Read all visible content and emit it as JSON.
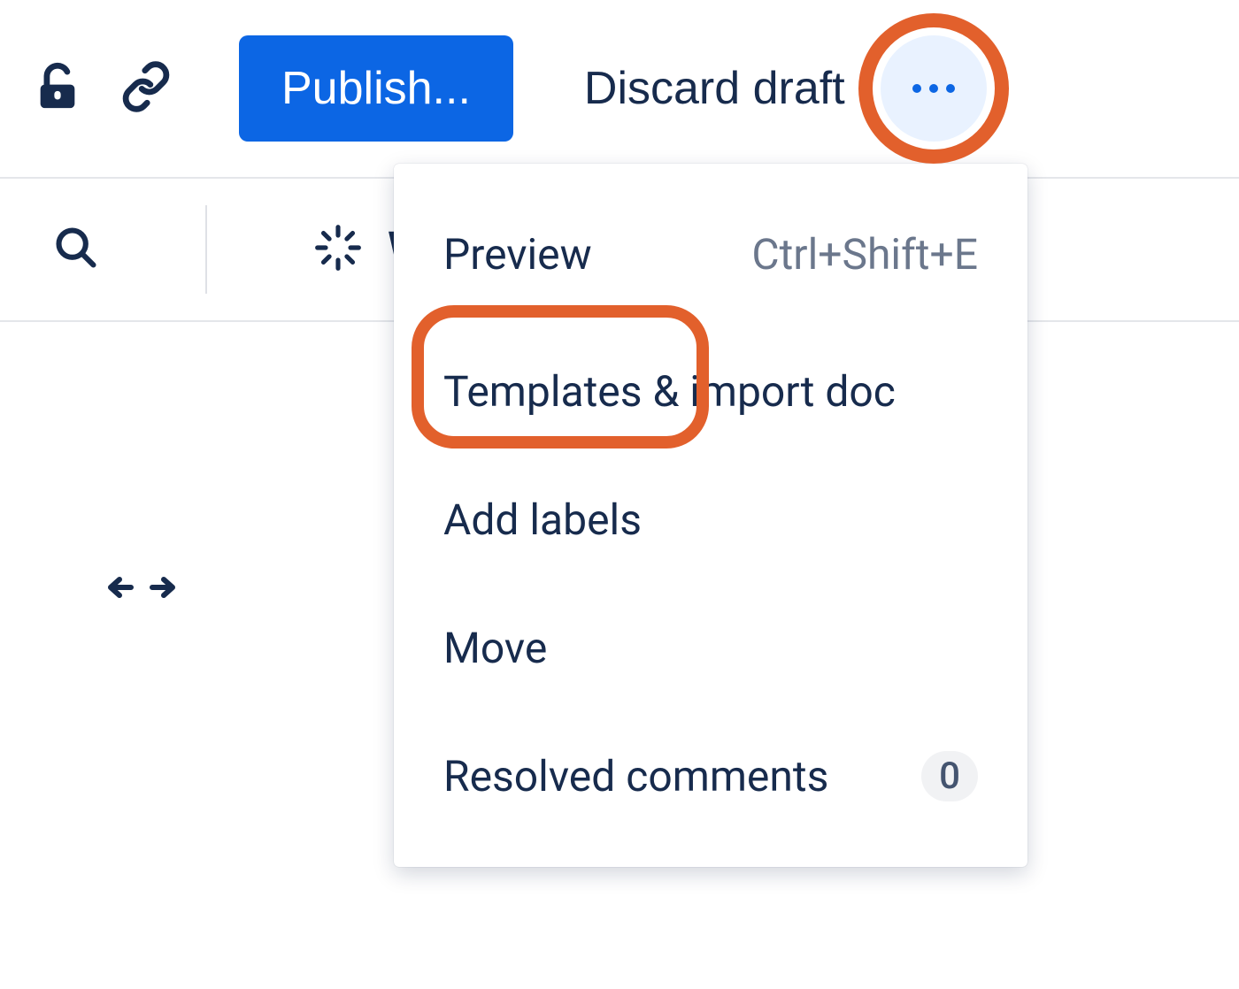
{
  "toolbar": {
    "publish_label": "Publish...",
    "discard_label": "Discard draft"
  },
  "sub_toolbar": {
    "spinner_letter": "W"
  },
  "menu": {
    "items": [
      {
        "label": "Preview",
        "shortcut": "Ctrl+Shift+E"
      },
      {
        "label": "Templates & import doc"
      },
      {
        "label": "Add labels"
      },
      {
        "label": "Move"
      },
      {
        "label": "Resolved comments",
        "badge": "0"
      }
    ]
  },
  "colors": {
    "primary": "#0c66e4",
    "text": "#172b4d",
    "highlight": "#e2602c",
    "muted": "#6b778c"
  }
}
